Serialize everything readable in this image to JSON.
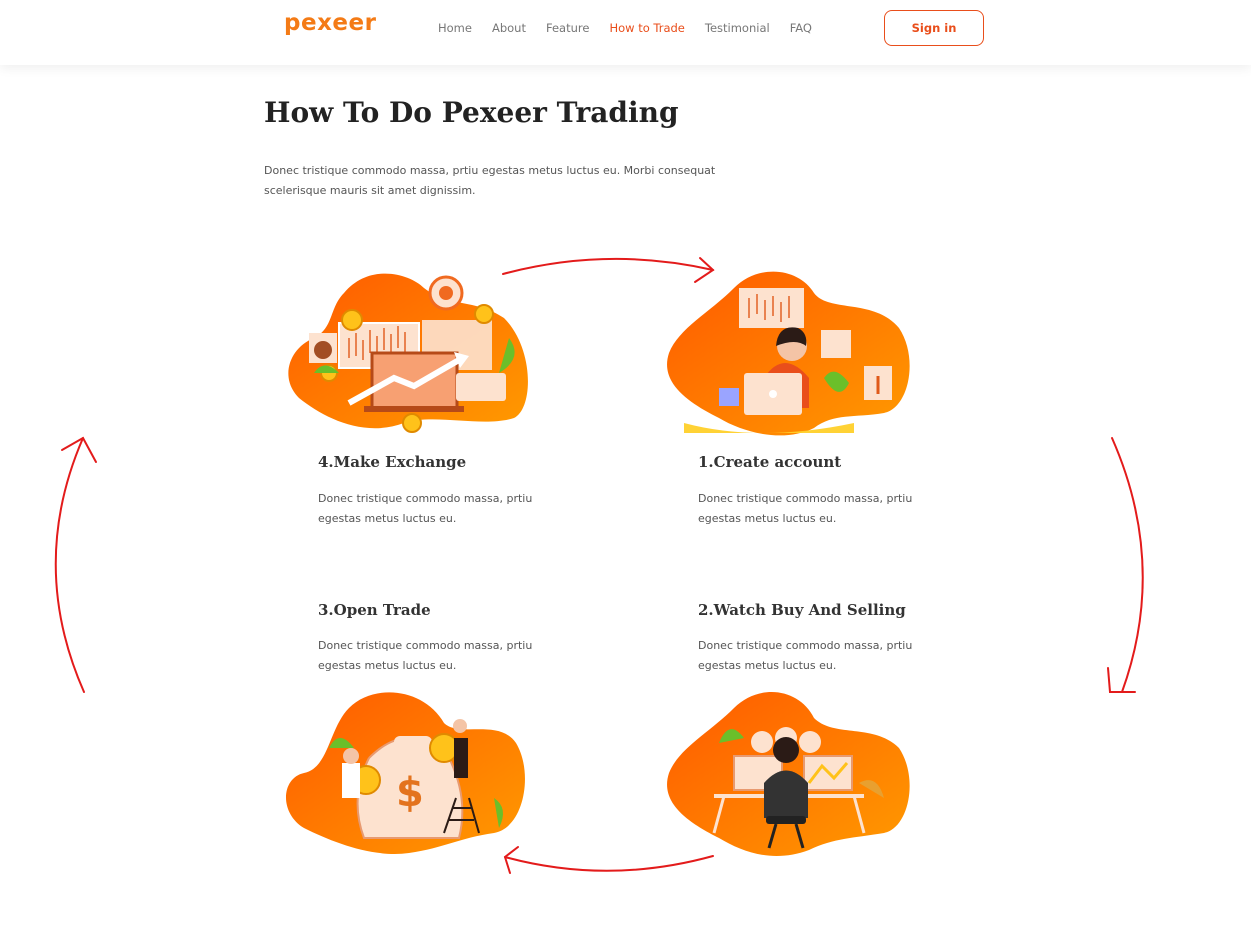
{
  "nav": {
    "logo": "pexeer",
    "links": [
      "Home",
      "About",
      "Feature",
      "How to Trade",
      "Testimonial",
      "FAQ"
    ],
    "active": "How to Trade",
    "signin_label": "Sign in"
  },
  "hero": {
    "title": "How To Do Pexeer Trading",
    "intro": "Donec tristique commodo massa, prtiu egestas metus luctus eu. Morbi consequat scelerisque mauris sit amet dignissim."
  },
  "steps": [
    {
      "title": "4.Make Exchange",
      "text": "Donec tristique commodo massa, prtiu egestas metus luctus eu."
    },
    {
      "title": "1.Create account",
      "text": "Donec tristique commodo massa, prtiu egestas metus luctus eu."
    },
    {
      "title": "3.Open Trade",
      "text": "Donec tristique commodo massa, prtiu egestas metus luctus eu."
    },
    {
      "title": "2.Watch Buy And Selling",
      "text": "Donec tristique commodo massa, prtiu egestas metus luctus eu."
    }
  ],
  "colors": {
    "accent": "#e94e1b",
    "logo": "#f47b16",
    "blob_orange": "#ff7a00",
    "arrow_red": "#e31b1b"
  }
}
